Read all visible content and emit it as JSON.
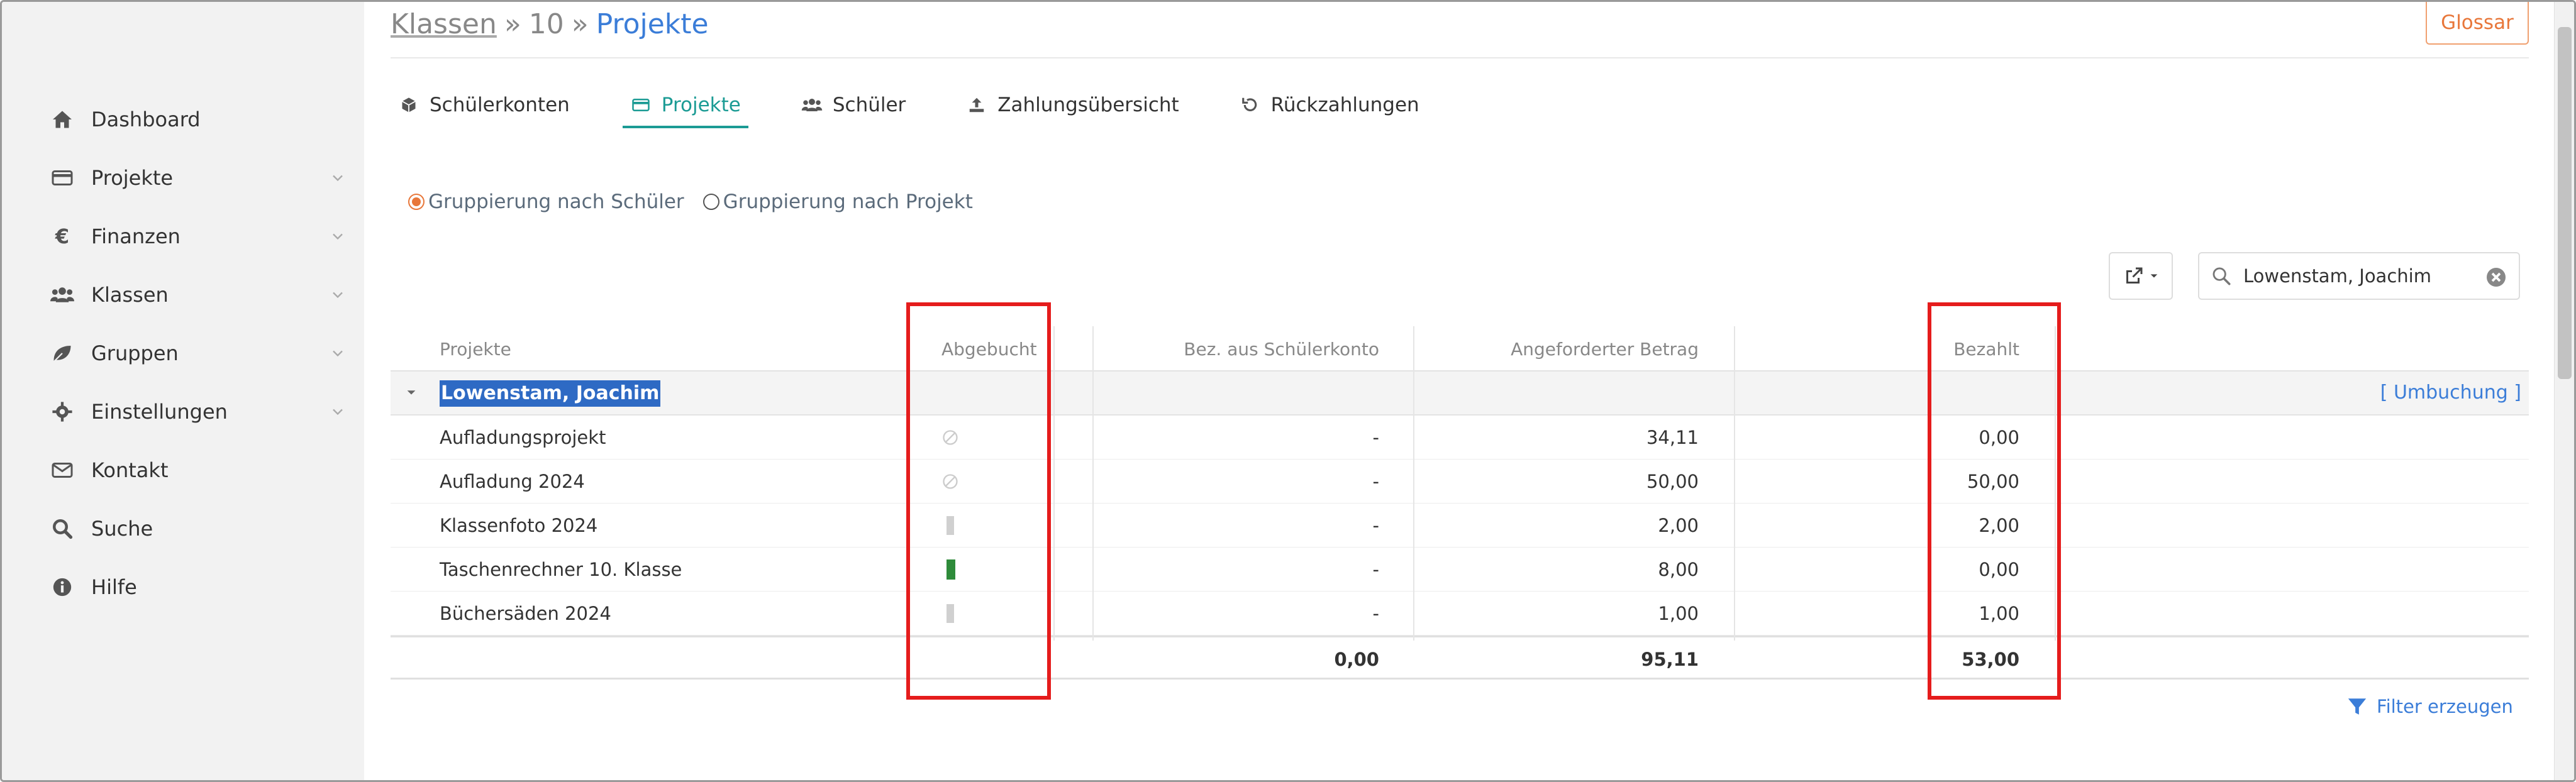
{
  "sidebar": {
    "items": [
      {
        "label": "Dashboard",
        "icon": "home-icon",
        "has_chevron": false
      },
      {
        "label": "Projekte",
        "icon": "card-icon",
        "has_chevron": true
      },
      {
        "label": "Finanzen",
        "icon": "euro-icon",
        "has_chevron": true
      },
      {
        "label": "Klassen",
        "icon": "users-icon",
        "has_chevron": true
      },
      {
        "label": "Gruppen",
        "icon": "leaf-icon",
        "has_chevron": true
      },
      {
        "label": "Einstellungen",
        "icon": "gear-icon",
        "has_chevron": true
      },
      {
        "label": "Kontakt",
        "icon": "mail-icon",
        "has_chevron": false
      },
      {
        "label": "Suche",
        "icon": "search-icon",
        "has_chevron": false
      },
      {
        "label": "Hilfe",
        "icon": "info-icon",
        "has_chevron": false
      }
    ]
  },
  "breadcrumb": {
    "root": "Klassen",
    "sep1": "»",
    "middle": "10",
    "sep2": "»",
    "current": "Projekte"
  },
  "glossar_label": "Glossar",
  "tabs": [
    {
      "label": "Schülerkonten",
      "icon": "cube-icon",
      "active": false
    },
    {
      "label": "Projekte",
      "icon": "card-icon",
      "active": true
    },
    {
      "label": "Schüler",
      "icon": "users-icon",
      "active": false
    },
    {
      "label": "Zahlungsübersicht",
      "icon": "upload-icon",
      "active": false
    },
    {
      "label": "Rückzahlungen",
      "icon": "undo-icon",
      "active": false
    }
  ],
  "grouping": {
    "option1": "Gruppierung nach Schüler",
    "option2": "Gruppierung nach Projekt",
    "selected": "option1"
  },
  "search": {
    "value": "Lowenstam, Joachim"
  },
  "table": {
    "columns": {
      "projekte": "Projekte",
      "abgebucht": "Abgebucht",
      "bez": "Bez. aus Schülerkonto",
      "angefordert": "Angeforderter Betrag",
      "bezahlt": "Bezahlt"
    },
    "group": {
      "name": "Lowenstam, Joachim",
      "action": "[ Umbuchung ]"
    },
    "rows": [
      {
        "projekt": "Aufladungsprojekt",
        "abgebucht": "disabled",
        "bez": "-",
        "angefordert": "34,11",
        "bezahlt": "0,00"
      },
      {
        "projekt": "Aufladung 2024",
        "abgebucht": "disabled",
        "bez": "-",
        "angefordert": "50,00",
        "bezahlt": "50,00"
      },
      {
        "projekt": "Klassenfoto 2024",
        "abgebucht": "gray",
        "bez": "-",
        "angefordert": "2,00",
        "bezahlt": "2,00"
      },
      {
        "projekt": "Taschenrechner 10. Klasse",
        "abgebucht": "green",
        "bez": "-",
        "angefordert": "8,00",
        "bezahlt": "0,00"
      },
      {
        "projekt": "Büchersäden 2024",
        "abgebucht": "gray",
        "bez": "-",
        "angefordert": "1,00",
        "bezahlt": "1,00"
      }
    ],
    "totals": {
      "bez": "0,00",
      "angefordert": "95,11",
      "bezahlt": "53,00"
    }
  },
  "filter_label": "Filter erzeugen",
  "colors": {
    "accent_teal": "#1b9b94",
    "link_blue": "#3b7dd8",
    "orange": "#e8773a",
    "highlight_red": "#e51c1c",
    "status_green": "#2e8b3a"
  }
}
